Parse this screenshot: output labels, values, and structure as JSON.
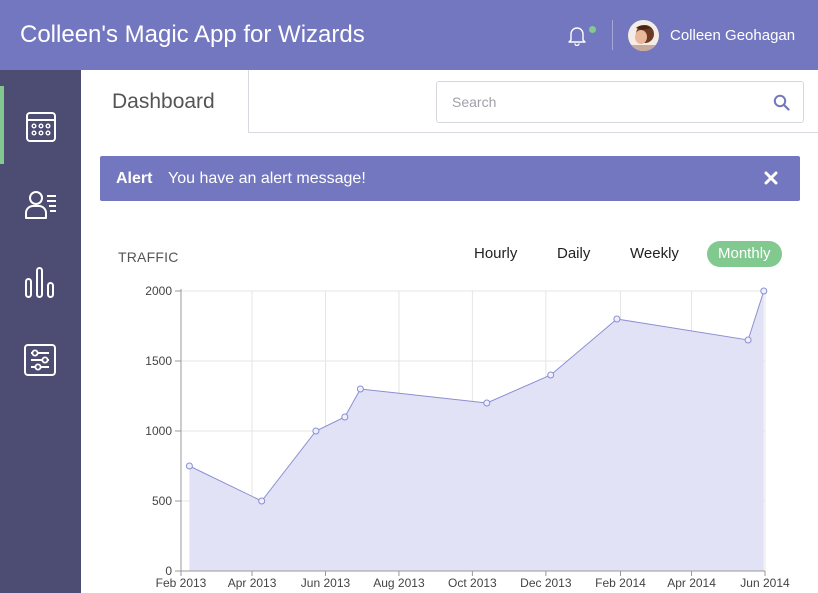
{
  "header": {
    "app_title": "Colleen's Magic App for Wizards",
    "user_name": "Colleen Geohagan",
    "bell_icon": "bell-icon",
    "notification_color": "#81c98f"
  },
  "colors": {
    "brand": "#7377bf",
    "sidebar": "#4d4c72",
    "accent": "#81c98f",
    "chart_fill": "#e2e2f6",
    "chart_line": "#8b8fd0"
  },
  "sidebar": {
    "items": [
      {
        "icon": "calendar-icon",
        "active": true
      },
      {
        "icon": "members-icon",
        "active": false
      },
      {
        "icon": "bar-chart-icon",
        "active": false
      },
      {
        "icon": "settings-sliders-icon",
        "active": false
      }
    ]
  },
  "tabs": {
    "dashboard_label": "Dashboard"
  },
  "search": {
    "placeholder": "Search",
    "value": ""
  },
  "alert": {
    "title": "Alert",
    "message": "You have an alert message!"
  },
  "traffic": {
    "label": "TRAFFIC",
    "ranges": [
      "Hourly",
      "Daily",
      "Weekly",
      "Monthly"
    ],
    "selected_range": "Monthly"
  },
  "chart_data": {
    "type": "area",
    "title": "",
    "xlabel": "",
    "ylabel": "",
    "ylim": [
      0,
      2000
    ],
    "yticks": [
      0,
      500,
      1000,
      1500,
      2000
    ],
    "xticks": [
      "Feb 2013",
      "Apr 2013",
      "Jun 2013",
      "Aug 2013",
      "Oct 2013",
      "Dec 2013",
      "Feb 2014",
      "Apr 2014",
      "Jun 2014"
    ],
    "grid": true,
    "series": [
      {
        "x": [
          "2013-02-08",
          "2013-04-09",
          "2013-05-24",
          "2013-06-17",
          "2013-06-30",
          "2013-10-13",
          "2013-12-05",
          "2014-01-29",
          "2014-05-18",
          "2014-05-31"
        ],
        "values": [
          750,
          500,
          1000,
          1100,
          1300,
          1200,
          1400,
          1800,
          1650,
          2000
        ]
      }
    ]
  }
}
